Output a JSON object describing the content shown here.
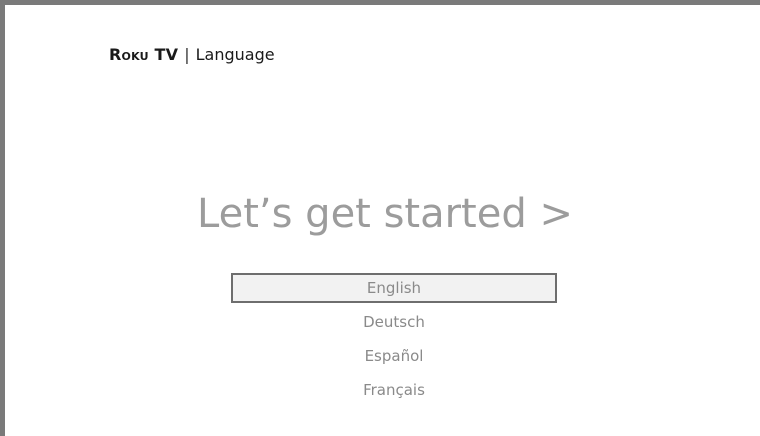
{
  "header": {
    "brand": "Roku",
    "brand_tv": "TV",
    "separator": "|",
    "screen": "Language"
  },
  "main": {
    "headline": "Let’s get started >",
    "languages": [
      {
        "label": "English",
        "selected": true
      },
      {
        "label": "Deutsch",
        "selected": false
      },
      {
        "label": "Español",
        "selected": false
      },
      {
        "label": "Français",
        "selected": false
      }
    ]
  }
}
